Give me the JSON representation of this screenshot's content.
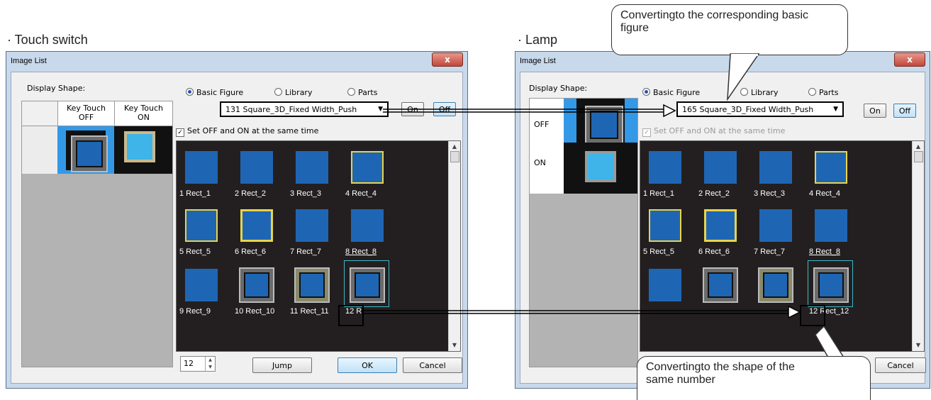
{
  "headings": {
    "left": "· Touch switch",
    "right": "· Lamp"
  },
  "callouts": {
    "top": "Convertingto the corresponding basic figure",
    "bottom": "Convertingto the shape of the same number"
  },
  "left_window": {
    "title": "Image List",
    "close": "x",
    "display_shape_label": "Display Shape:",
    "col_off": "Key Touch OFF",
    "col_on": "Key Touch ON",
    "radio_basic": "Basic Figure",
    "radio_library": "Library",
    "radio_parts": "Parts",
    "dropdown_value": "131 Square_3D_Fixed Width_Push",
    "on_label": "On",
    "off_label": "Off",
    "set_checkbox": "Set OFF and ON at the same time",
    "spin_value": "12",
    "jump": "Jump",
    "ok": "OK",
    "cancel": "Cancel",
    "items": [
      "1 Rect_1",
      "2 Rect_2",
      "3 Rect_3",
      "4 Rect_4",
      "5 Rect_5",
      "6 Rect_6",
      "7 Rect_7",
      "8 Rect_8",
      "9 Rect_9",
      "10 Rect_10",
      "11 Rect_11",
      "12 R"
    ]
  },
  "right_window": {
    "title": "Image List",
    "close": "x",
    "display_shape_label": "Display Shape:",
    "row_off": "OFF",
    "row_on": "ON",
    "radio_basic": "Basic Figure",
    "radio_library": "Library",
    "radio_parts": "Parts",
    "dropdown_value": "165 Square_3D_Fixed Width_Push",
    "on_label": "On",
    "off_label": "Off",
    "set_checkbox": "Set OFF and ON at the same time",
    "cancel": "Cancel",
    "items": [
      "1 Rect_1",
      "2 Rect_2",
      "3 Rect_3",
      "4 Rect_4",
      "5 Rect_5",
      "6 Rect_6",
      "7 Rect_7",
      "8 Rect_8",
      "",
      "",
      "",
      "12 Rect_12"
    ]
  },
  "colors": {
    "figure_blue": "#1e66b4",
    "light_blue": "#3fb4e8",
    "grid_bg": "#231f20"
  }
}
